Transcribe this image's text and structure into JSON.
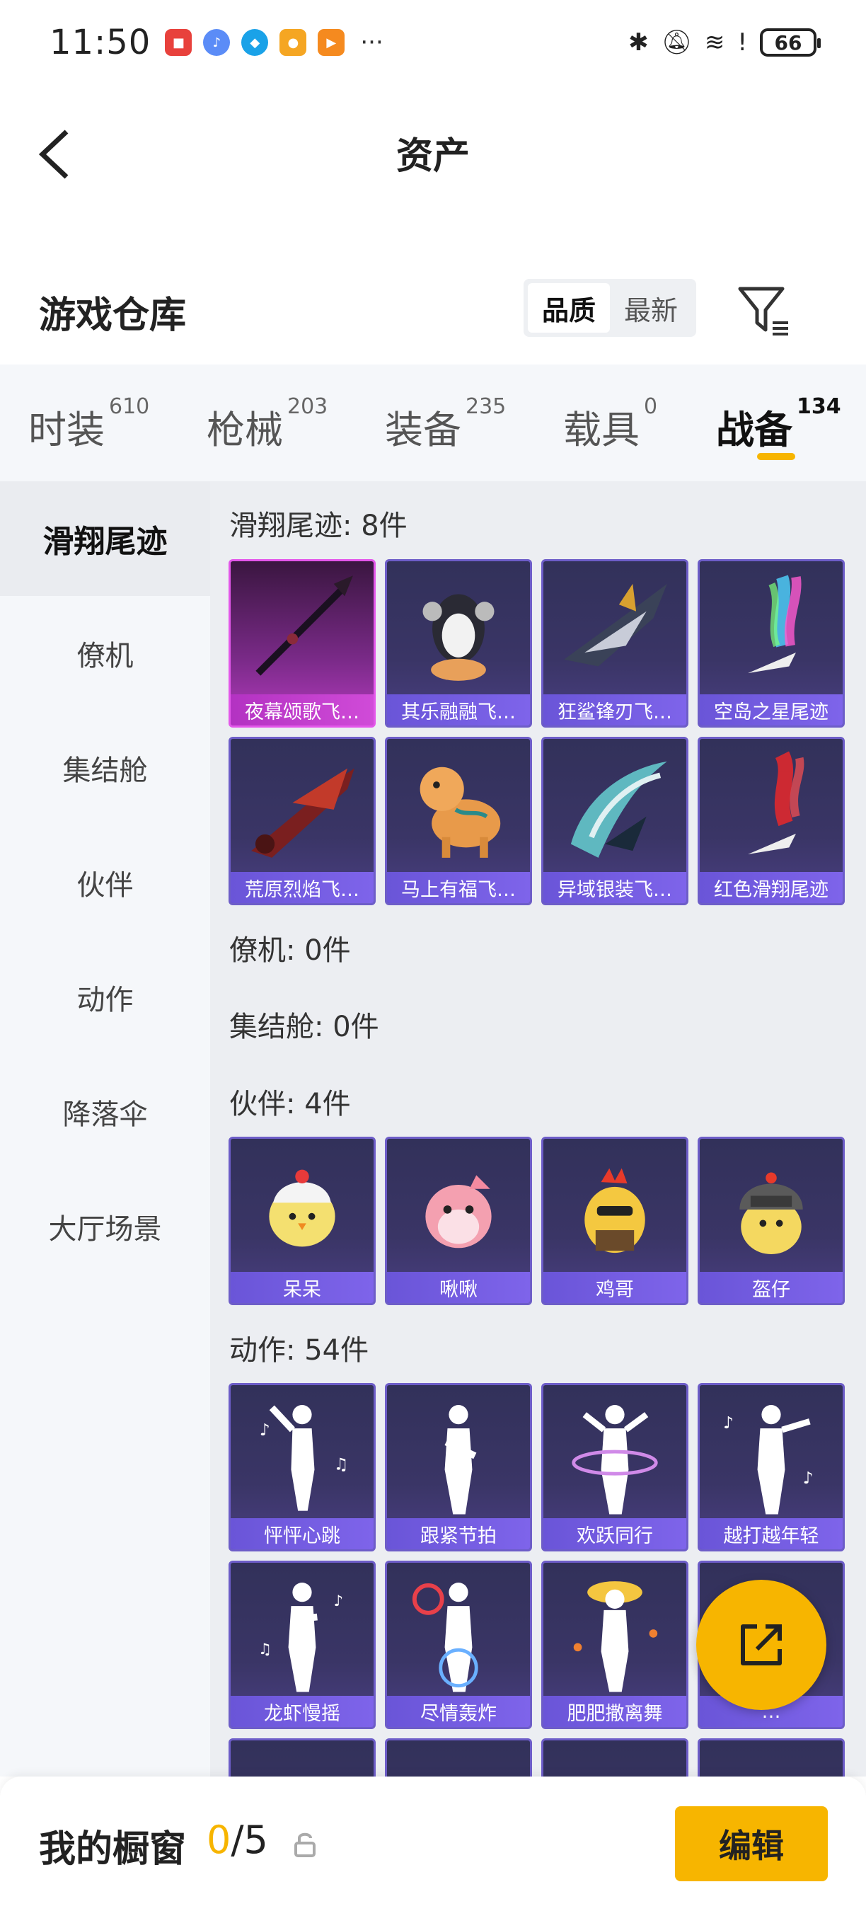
{
  "status_bar": {
    "time": "11:50",
    "battery": "66",
    "app_icons": [
      {
        "icon": "huawei-app-icon",
        "color": "#e8413c"
      },
      {
        "icon": "music-app-icon",
        "color": "#5b8cf7"
      },
      {
        "icon": "browser-app-icon",
        "color": "#1aa2e8"
      },
      {
        "icon": "coffee-app-icon",
        "color": "#f5a623"
      },
      {
        "icon": "video-app-icon",
        "color": "#f58a1f"
      }
    ],
    "more": "···"
  },
  "nav": {
    "title": "资产"
  },
  "header": {
    "warehouse_title": "游戏仓库",
    "sort_options": [
      "品质",
      "最新"
    ],
    "sort_selected": "品质"
  },
  "tabs": [
    {
      "label": "时装",
      "count": "610"
    },
    {
      "label": "枪械",
      "count": "203"
    },
    {
      "label": "装备",
      "count": "235"
    },
    {
      "label": "载具",
      "count": "0"
    },
    {
      "label": "战备",
      "count": "134",
      "active": true
    }
  ],
  "side_menu": [
    {
      "label": "滑翔尾迹",
      "active": true
    },
    {
      "label": "僚机"
    },
    {
      "label": "集结舱"
    },
    {
      "label": "伙伴"
    },
    {
      "label": "动作"
    },
    {
      "label": "降落伞"
    },
    {
      "label": "大厅场景"
    }
  ],
  "sections": {
    "glide": {
      "title": "滑翔尾迹: 8件",
      "items": [
        "夜幕颂歌飞…",
        "其乐融融飞…",
        "狂鲨锋刃飞…",
        "空岛之星尾迹",
        "荒原烈焰飞…",
        "马上有福飞…",
        "异域银装飞…",
        "红色滑翔尾迹"
      ]
    },
    "wingman": {
      "title": "僚机: 0件"
    },
    "pod": {
      "title": "集结舱: 0件"
    },
    "partner": {
      "title": "伙伴: 4件",
      "items": [
        "呆呆",
        "啾啾",
        "鸡哥",
        "盔仔"
      ]
    },
    "emote": {
      "title": "动作: 54件",
      "items": [
        "怦怦心跳",
        "跟紧节拍",
        "欢跃同行",
        "越打越年轻",
        "龙虾慢摇",
        "尽情轰炸",
        "肥肥撒离舞",
        "…"
      ]
    }
  },
  "bottom_bar": {
    "label": "我的橱窗",
    "count_current": "0",
    "count_total": "/5",
    "edit_label": "编辑"
  },
  "colors": {
    "accent": "#f7b500",
    "card_purple": "#6d5dc8",
    "card_pink": "#e357ea"
  }
}
